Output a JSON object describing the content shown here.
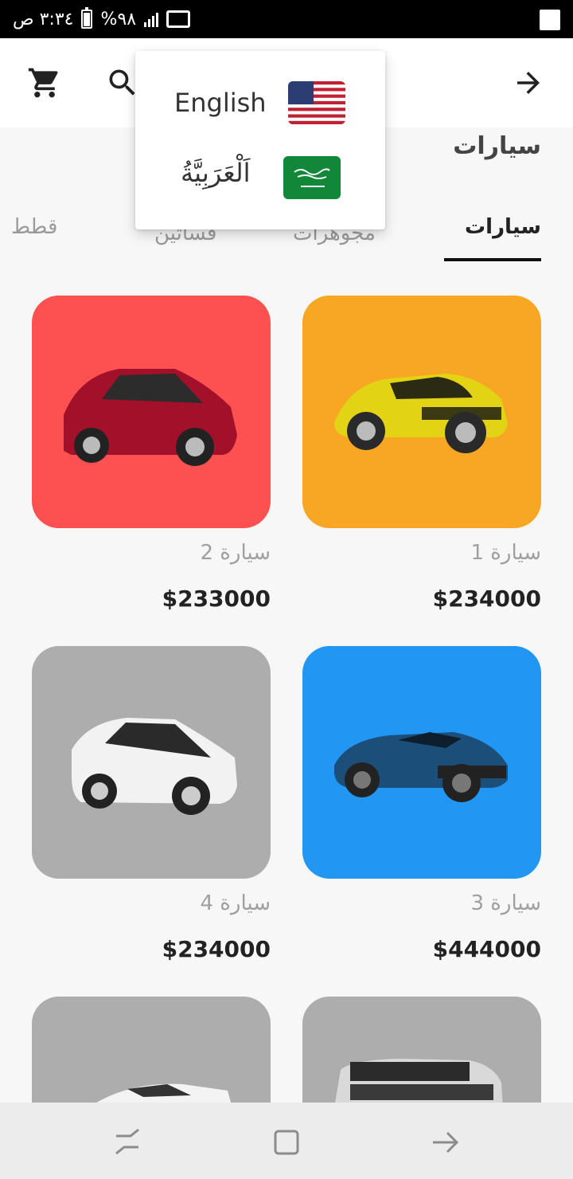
{
  "status_bar": {
    "time": "٣:٣٤ ص",
    "battery": "%٩٨",
    "battery_level": 0.98
  },
  "app_bar": {
    "cart_icon": "cart-icon",
    "search_icon": "search-icon",
    "forward_icon": "arrow-forward-icon"
  },
  "page": {
    "title": "سيارات"
  },
  "tabs": [
    {
      "label": "سيارات",
      "active": true
    },
    {
      "label": "مجوهرات",
      "active": false
    },
    {
      "label": "فساتين",
      "active": false
    },
    {
      "label": "قطط",
      "active": false
    }
  ],
  "language_menu": {
    "items": [
      {
        "label": "English",
        "flag": "us-flag"
      },
      {
        "label": "اَلْعَرَبِيَّةُ",
        "flag": "saudi-flag"
      }
    ]
  },
  "products": [
    {
      "name": "سيارة 1",
      "price": "$234000",
      "bg": "#f7a723"
    },
    {
      "name": "سيارة 2",
      "price": "$233000",
      "bg": "#fc5150"
    },
    {
      "name": "سيارة 3",
      "price": "$444000",
      "bg": "#2196f3"
    },
    {
      "name": "سيارة 4",
      "price": "$234000",
      "bg": "#adadad"
    },
    {
      "name": "",
      "price": "",
      "bg": "#adadad"
    },
    {
      "name": "",
      "price": "",
      "bg": "#adadad"
    }
  ],
  "nav_bar": {
    "recent_icon": "recent-apps-icon",
    "home_icon": "home-icon",
    "back_icon": "back-icon"
  }
}
